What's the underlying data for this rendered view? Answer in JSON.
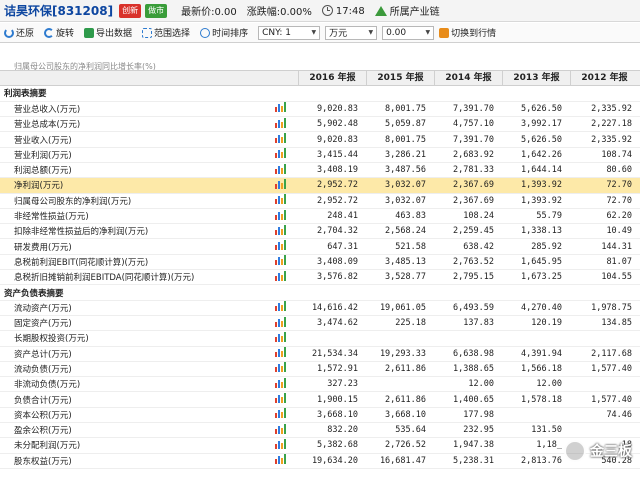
{
  "header": {
    "stock_name": "诘昊环保[831208]",
    "badge_innovation": "创新",
    "badge_market_maker": "做市",
    "latest_price": "最新价:0.00",
    "change": "涨跌幅:0.00%",
    "time": "17:48",
    "industry_chain": "所属产业链"
  },
  "toolbar": {
    "restore": "还原",
    "rotate": "旋转",
    "export": "导出数据",
    "range_select": "范围选择",
    "time_sort": "时间排序",
    "currency_value": "CNY: 1",
    "unit_value": "万元",
    "decimals_value": "0.00",
    "switch_rows": "切换到行情"
  },
  "top_partial_row": "归属母公司股东的净利润同比增长率(%)",
  "columns": [
    "",
    "2016 年报",
    "2015 年报",
    "2014 年报",
    "2013 年报",
    "2012 年报"
  ],
  "rows": [
    {
      "type": "section",
      "label": "利润表摘要"
    },
    {
      "label": "营业总收入(万元)",
      "values": [
        "9,020.83",
        "8,001.75",
        "7,391.70",
        "5,626.50",
        "2,335.92"
      ]
    },
    {
      "label": "营业总成本(万元)",
      "values": [
        "5,902.48",
        "5,059.87",
        "4,757.10",
        "3,992.17",
        "2,227.18"
      ]
    },
    {
      "label": "营业收入(万元)",
      "values": [
        "9,020.83",
        "8,001.75",
        "7,391.70",
        "5,626.50",
        "2,335.92"
      ]
    },
    {
      "label": "营业利润(万元)",
      "values": [
        "3,415.44",
        "3,286.21",
        "2,683.92",
        "1,642.26",
        "108.74"
      ]
    },
    {
      "label": "利润总额(万元)",
      "values": [
        "3,408.19",
        "3,487.56",
        "2,781.33",
        "1,644.14",
        "80.60"
      ]
    },
    {
      "label": "净利润(万元)",
      "values": [
        "2,952.72",
        "3,032.07",
        "2,367.69",
        "1,393.92",
        "72.70"
      ],
      "highlight": true
    },
    {
      "label": "归属母公司股东的净利润(万元)",
      "values": [
        "2,952.72",
        "3,032.07",
        "2,367.69",
        "1,393.92",
        "72.70"
      ]
    },
    {
      "label": "非经常性损益(万元)",
      "values": [
        "248.41",
        "463.83",
        "108.24",
        "55.79",
        "62.20"
      ]
    },
    {
      "label": "扣除非经常性损益后的净利润(万元)",
      "values": [
        "2,704.32",
        "2,568.24",
        "2,259.45",
        "1,338.13",
        "10.49"
      ]
    },
    {
      "label": "研发费用(万元)",
      "values": [
        "647.31",
        "521.58",
        "638.42",
        "285.92",
        "144.31"
      ]
    },
    {
      "label": "息税前利润EBIT(同花顺计算)(万元)",
      "values": [
        "3,408.09",
        "3,485.13",
        "2,763.52",
        "1,645.95",
        "81.07"
      ]
    },
    {
      "label": "息税折旧摊销前利润EBITDA(同花顺计算)(万元)",
      "values": [
        "3,576.82",
        "3,528.77",
        "2,795.15",
        "1,673.25",
        "104.55"
      ]
    },
    {
      "type": "section",
      "label": "资产负债表摘要"
    },
    {
      "label": "流动资产(万元)",
      "values": [
        "14,616.42",
        "19,061.05",
        "6,493.59",
        "4,270.40",
        "1,978.75"
      ]
    },
    {
      "label": "固定资产(万元)",
      "values": [
        "3,474.62",
        "225.18",
        "137.83",
        "120.19",
        "134.85"
      ]
    },
    {
      "label": "长期股权投资(万元)",
      "values": [
        "",
        "",
        "",
        "",
        ""
      ]
    },
    {
      "label": "资产总计(万元)",
      "values": [
        "21,534.34",
        "19,293.33",
        "6,638.98",
        "4,391.94",
        "2,117.68"
      ]
    },
    {
      "label": "流动负债(万元)",
      "values": [
        "1,572.91",
        "2,611.86",
        "1,388.65",
        "1,566.18",
        "1,577.40"
      ]
    },
    {
      "label": "非流动负债(万元)",
      "values": [
        "327.23",
        "",
        "12.00",
        "12.00",
        ""
      ]
    },
    {
      "label": "负债合计(万元)",
      "values": [
        "1,900.15",
        "2,611.86",
        "1,400.65",
        "1,578.18",
        "1,577.40"
      ]
    },
    {
      "label": "资本公积(万元)",
      "values": [
        "3,668.10",
        "3,668.10",
        "177.98",
        "",
        "74.46"
      ]
    },
    {
      "label": "盈余公积(万元)",
      "values": [
        "832.20",
        "535.64",
        "232.95",
        "131.50",
        ""
      ]
    },
    {
      "label": "未分配利润(万元)",
      "values": [
        "5,382.68",
        "2,726.52",
        "1,947.38",
        "1,18_",
        "18"
      ]
    },
    {
      "label": "股东权益(万元)",
      "values": [
        "19,634.20",
        "16,681.47",
        "5,238.31",
        "2,813.76",
        "540.28"
      ]
    }
  ],
  "watermark": "金三板",
  "colors": {
    "badge_red": "#d9322b",
    "badge_green": "#3a9d3a",
    "highlight_row": "#fde9a8",
    "title_blue": "#0d46a0"
  }
}
